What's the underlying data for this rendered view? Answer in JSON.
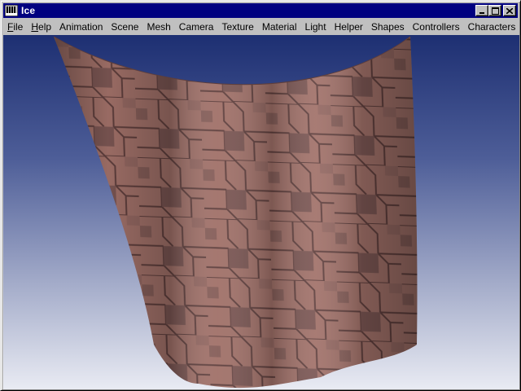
{
  "window": {
    "title": "Ice",
    "icon": "ice-app-icon",
    "buttons": {
      "minimize_icon": "minimize-icon",
      "maximize_icon": "maximize-icon",
      "close_icon": "close-icon"
    }
  },
  "menu": [
    {
      "mnemonic": "F",
      "rest": "ile"
    },
    {
      "mnemonic": "H",
      "rest": "elp"
    },
    {
      "mnemonic": "",
      "rest": "Animation"
    },
    {
      "mnemonic": "",
      "rest": "Scene"
    },
    {
      "mnemonic": "",
      "rest": "Mesh"
    },
    {
      "mnemonic": "",
      "rest": "Camera"
    },
    {
      "mnemonic": "",
      "rest": "Texture"
    },
    {
      "mnemonic": "",
      "rest": "Material"
    },
    {
      "mnemonic": "",
      "rest": "Light"
    },
    {
      "mnemonic": "",
      "rest": "Helper"
    },
    {
      "mnemonic": "",
      "rest": "Shapes"
    },
    {
      "mnemonic": "",
      "rest": "Controllers"
    },
    {
      "mnemonic": "",
      "rest": "Characters"
    }
  ],
  "viewport": {
    "content": "cloth-mesh",
    "colors": {
      "sky_top": "#1d2f72",
      "sky_bottom": "#e9ebf3",
      "cloth_base": "#a07068",
      "cloth_mortar": "#6e4a48"
    }
  }
}
